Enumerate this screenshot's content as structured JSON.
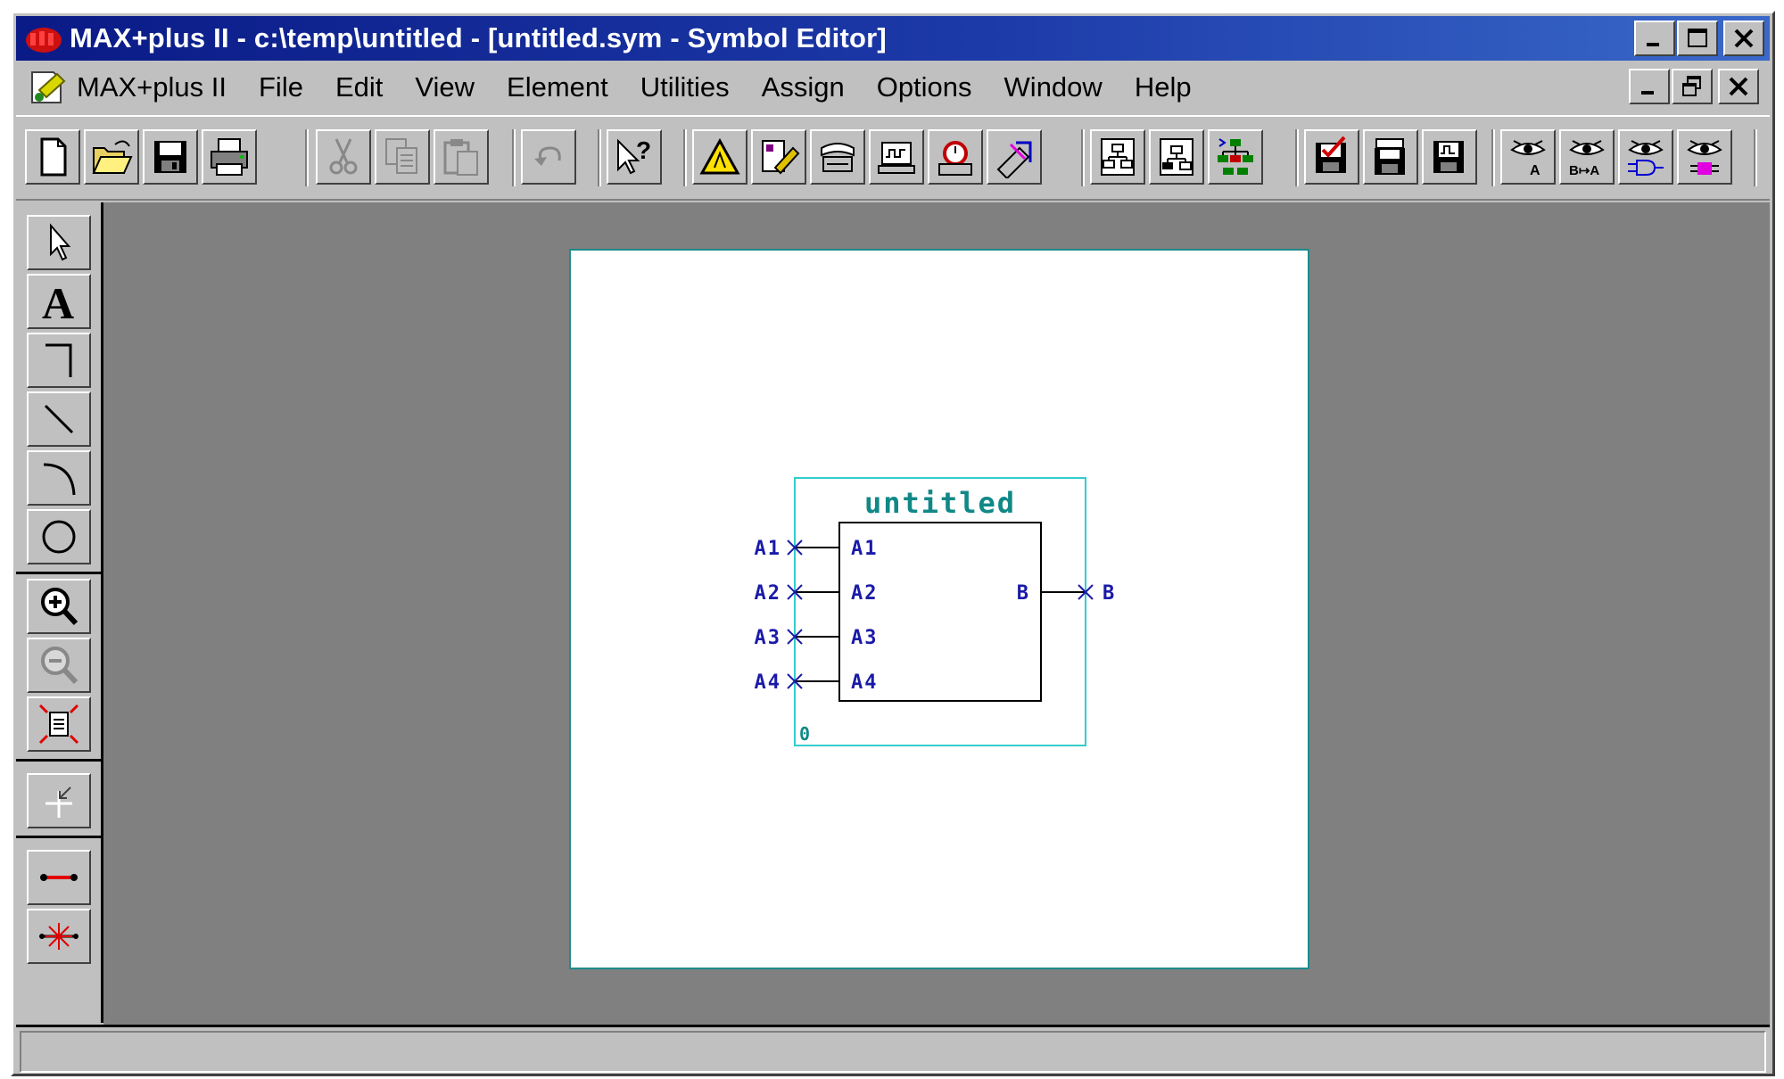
{
  "titlebar": {
    "title": "MAX+plus II - c:\\temp\\untitled - [untitled.sym - Symbol Editor]",
    "icon": "maxplus-app-icon",
    "color_start": "#0a1a86",
    "color_end": "#3a69c9"
  },
  "menubar": {
    "items": [
      {
        "label": "MAX+plus II"
      },
      {
        "label": "File"
      },
      {
        "label": "Edit"
      },
      {
        "label": "View"
      },
      {
        "label": "Element"
      },
      {
        "label": "Utilities"
      },
      {
        "label": "Assign"
      },
      {
        "label": "Options"
      },
      {
        "label": "Window"
      },
      {
        "label": "Help"
      }
    ]
  },
  "toolbar": {
    "buttons": [
      "new",
      "open",
      "save",
      "print",
      "cut",
      "copy",
      "paste",
      "undo",
      "context-help",
      "hierarchy-display",
      "floorplan-editor",
      "compiler",
      "simulator",
      "timing-analyzer",
      "programmer",
      "open-hierarchy-up",
      "open-hierarchy-down",
      "hierarchy-top",
      "project-save-check",
      "project-save-compile",
      "project-save-simulate",
      "find-node-design-file",
      "find-node-source",
      "find-node-floorplan",
      "find-node-report"
    ],
    "labels": {
      "find_a": "A",
      "find_ba": "B↦A"
    }
  },
  "palette": {
    "tools": [
      "selection",
      "text",
      "orthogonal-line",
      "diagonal-line",
      "arc",
      "circle",
      "zoom-in",
      "zoom-out",
      "fit-in-window",
      "pin-tool",
      "rubberbanding",
      "connection-dots"
    ],
    "text_tool_label": "A"
  },
  "symbol": {
    "name": "untitled",
    "inputs": [
      "A1",
      "A2",
      "A3",
      "A4"
    ],
    "output": "B",
    "instance_number": "0",
    "border_color": "#33cccc",
    "name_color": "#118888",
    "pin_color": "#1a1aa8"
  },
  "statusbar": {
    "text": ""
  }
}
